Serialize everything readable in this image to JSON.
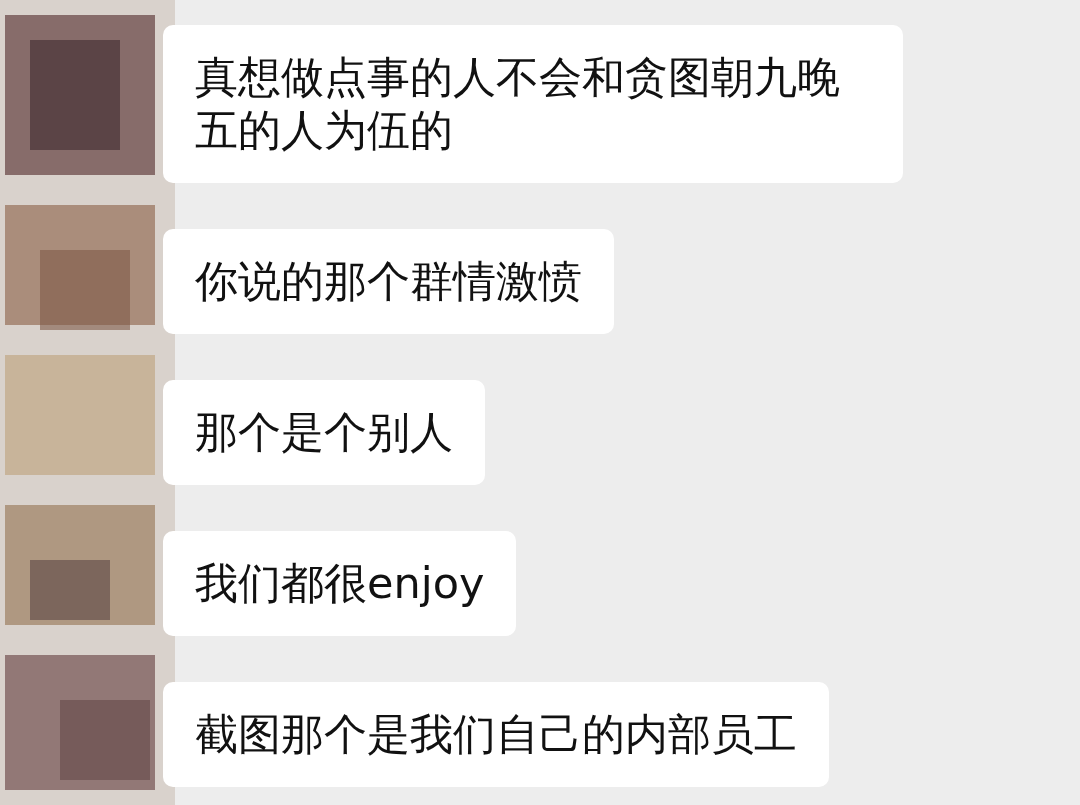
{
  "messages": [
    {
      "text": "真想做点事的人不会和贪图朝九晚五的人为伍的"
    },
    {
      "text": "你说的那个群情激愤"
    },
    {
      "text": "那个是个别人"
    },
    {
      "text": "我们都很enjoy"
    },
    {
      "text": "截图那个是我们自己的内部员工"
    }
  ]
}
